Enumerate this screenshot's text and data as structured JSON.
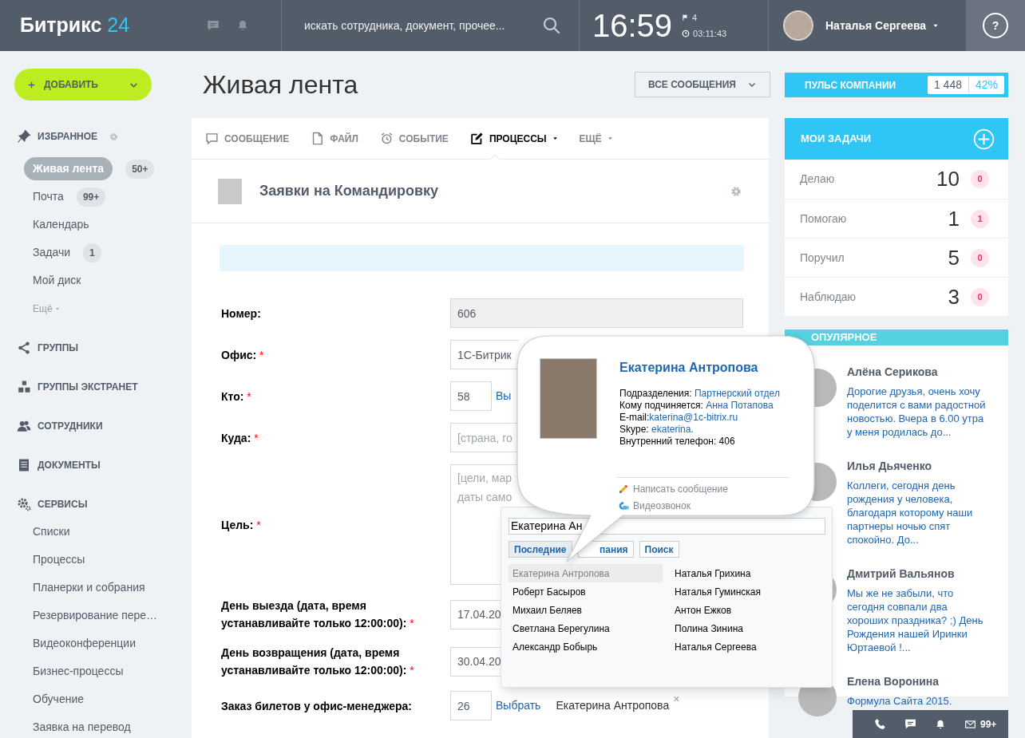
{
  "header": {
    "logo": "Битрикс",
    "logo_number": "24",
    "search_placeholder": "искать сотрудника, документ, прочее...",
    "time": "16:59",
    "flags": "4",
    "timer": "03:11:43",
    "user": "Наталья Сергеева",
    "help": "?"
  },
  "add_button": "ДОБАВИТЬ",
  "sidebar": [
    {
      "kind": "favorites",
      "title": "ИЗБРАННОЕ",
      "items": [
        {
          "label": "Живая лента",
          "badge": "50+",
          "selected": true
        },
        {
          "label": "Почта",
          "badge": "99+",
          "selected": false
        },
        {
          "label": "Календарь",
          "selected": false
        },
        {
          "label": "Задачи",
          "badge": "1",
          "selected": false
        },
        {
          "label": "Мой диск",
          "selected": false
        },
        {
          "label": "Ещё",
          "kind": "more",
          "selected": false
        }
      ]
    },
    {
      "kind": "groups",
      "title": "ГРУППЫ"
    },
    {
      "kind": "extranet",
      "title": "ГРУППЫ ЭКСТРАНЕТ"
    },
    {
      "kind": "employees",
      "title": "СОТРУДНИКИ"
    },
    {
      "kind": "documents",
      "title": "ДОКУМЕНТЫ"
    },
    {
      "kind": "services",
      "title": "СЕРВИСЫ",
      "items": [
        {
          "label": "Списки",
          "selected": false
        },
        {
          "label": "Процессы",
          "selected": false
        },
        {
          "label": "Планерки и собрания",
          "selected": false
        },
        {
          "label": "Резервирование пере…",
          "selected": false
        },
        {
          "label": "Видеоконференции",
          "selected": false
        },
        {
          "label": "Бизнес-процессы",
          "selected": false
        },
        {
          "label": "Обучение",
          "selected": false
        },
        {
          "label": "Заявка на перевод",
          "selected": false
        }
      ]
    }
  ],
  "page_title": "Живая лента",
  "filter": "ВСЕ СООБЩЕНИЯ",
  "pulse": {
    "label": "ПУЛЬС КОМПАНИИ",
    "count": "1 448",
    "percent": "42%"
  },
  "composer_tabs": [
    {
      "kind": "message",
      "label": "СООБЩЕНИЕ",
      "selected": false
    },
    {
      "kind": "file",
      "label": "ФАЙЛ",
      "selected": false
    },
    {
      "kind": "event",
      "label": "СОБЫТИЕ",
      "selected": false
    },
    {
      "kind": "process",
      "label": "ПРОЦЕССЫ",
      "dropdown": true,
      "selected": true
    },
    {
      "kind": "more",
      "label": "ЕЩЁ",
      "dropdown": true,
      "selected": false
    }
  ],
  "form": {
    "title": "Заявки на Командировку",
    "fields": [
      {
        "label": "Номер:",
        "kind": "readonly",
        "value": "606"
      },
      {
        "label": "Офис:",
        "required_mark": "*",
        "kind": "text",
        "value": "1С-Битрик"
      },
      {
        "label": "Кто:",
        "required_mark": "*",
        "kind": "user",
        "value": "58",
        "link": "Вы"
      },
      {
        "label": "Куда:",
        "required_mark": "*",
        "kind": "text",
        "placeholder": "[страна, го"
      },
      {
        "label": "Цель:",
        "required_mark": "*",
        "kind": "textarea",
        "placeholder": "[цели, мар\nдаты само"
      },
      {
        "label": "День выезда (дата, время устанавливайте только 12:00:00):",
        "required_mark": "*",
        "kind": "text",
        "value": "17.04.20"
      },
      {
        "label": "День возвращения (дата, время устанавливайте только 12:00:00):",
        "required_mark": "*",
        "kind": "text",
        "value": "30.04.20"
      },
      {
        "label": "Заказ билетов у офис-менеджера:",
        "kind": "user",
        "value": "26",
        "link": "Выбрать",
        "chosen": "Екатерина Антропова",
        "remove": "×"
      }
    ]
  },
  "tasks": {
    "title": "МОИ ЗАДАЧИ",
    "rows": [
      {
        "label": "Делаю",
        "count": "10",
        "new": "0"
      },
      {
        "label": "Помогаю",
        "count": "1",
        "new": "1"
      },
      {
        "label": "Поручил",
        "count": "5",
        "new": "0"
      },
      {
        "label": "Наблюдаю",
        "count": "3",
        "new": "0"
      }
    ]
  },
  "popular": {
    "title": "ОПУЛЯРНОЕ",
    "posts": [
      {
        "author": "Алёна Серикова",
        "text": "Дорогие друзья, очень хочу поделится с вами радостной новостью. Вчера в 6.00 утра у меня родилась до..."
      },
      {
        "author": "Илья Дьяченко",
        "text": "Коллеги, сегодня день рождения у человека, благодаря которому наши партнеры ночью спят спокойно. До..."
      },
      {
        "author": "Дмитрий Вальянов",
        "text": "Мы же не забыли, что сегодня совпали два хороших праздника? ;) День Рождения нашей Иринки Юртаевой !..."
      },
      {
        "author": "Елена Воронина",
        "text": "Формула Сайта 2015."
      }
    ]
  },
  "selector": {
    "value": "Екатерина Ан",
    "tabs": [
      {
        "label": "Последние",
        "selected": true
      },
      {
        "label": "пания",
        "selected": false
      },
      {
        "label": "Поиск",
        "selected": false
      }
    ],
    "people": [
      {
        "name": "Екатерина Антропова",
        "selected": true
      },
      {
        "name": "Роберт Басыров",
        "selected": false
      },
      {
        "name": "Михаил Беляев",
        "selected": false
      },
      {
        "name": "Светлана Берегулина",
        "selected": false
      },
      {
        "name": "Александр Бобырь",
        "selected": false
      },
      {
        "name": "Наталья Грихина",
        "selected": false
      },
      {
        "name": "Наталья Гуминская",
        "selected": false
      },
      {
        "name": "Антон Ежков",
        "selected": false
      },
      {
        "name": "Полина Зинина",
        "selected": false
      },
      {
        "name": "Наталья Сергеева",
        "selected": false
      }
    ]
  },
  "profile_card": {
    "name": "Екатерина Антропова",
    "lines": [
      {
        "label": "Подразделения: ",
        "value": "Партнерский отдел"
      },
      {
        "label": "Кому подчиняется: ",
        "value": "Анна Потапова"
      },
      {
        "label": "E-mail:",
        "value": "katerina@1c-bitrix.ru"
      },
      {
        "label": "Skype: ",
        "value": "ekaterina."
      },
      {
        "label": "Внутренний телефон: 406"
      }
    ],
    "actions": [
      {
        "kind": "message",
        "label": "Написать сообщение"
      },
      {
        "kind": "video",
        "label": "Видеозвонок"
      }
    ]
  },
  "bottom_bar": {
    "mail_count": "99+"
  }
}
